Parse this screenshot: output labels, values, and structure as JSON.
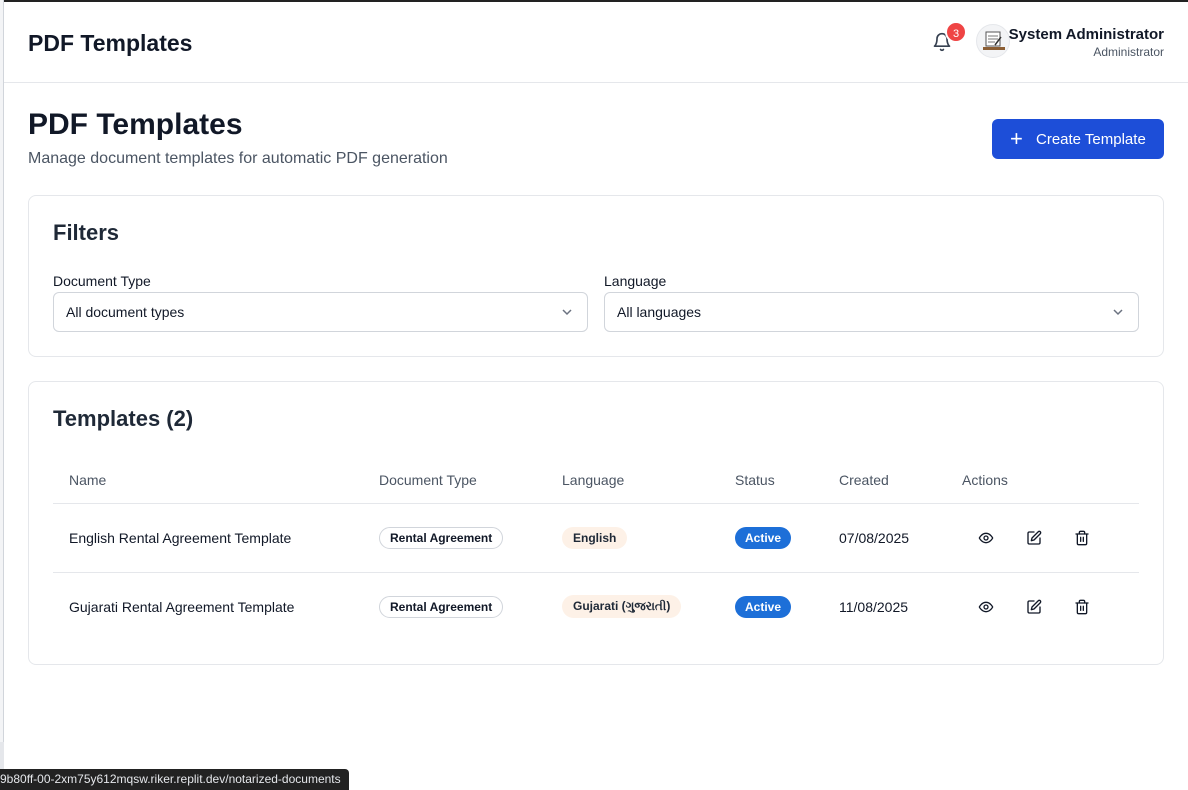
{
  "header": {
    "title": "PDF Templates",
    "notification_count": "3",
    "user_name": "System Administrator",
    "user_role": "Administrator"
  },
  "page": {
    "title": "PDF Templates",
    "subtitle": "Manage document templates for automatic PDF generation",
    "create_button": "Create Template"
  },
  "filters": {
    "title": "Filters",
    "document_type": {
      "label": "Document Type",
      "value": "All document types"
    },
    "language": {
      "label": "Language",
      "value": "All languages"
    }
  },
  "templates": {
    "title": "Templates (2)",
    "columns": [
      "Name",
      "Document Type",
      "Language",
      "Status",
      "Created",
      "Actions"
    ],
    "rows": [
      {
        "name": "English Rental Agreement Template",
        "document_type": "Rental Agreement",
        "language": "English",
        "status": "Active",
        "created": "07/08/2025"
      },
      {
        "name": "Gujarati Rental Agreement Template",
        "document_type": "Rental Agreement",
        "language": "Gujarati (ગુજરાતી)",
        "status": "Active",
        "created": "11/08/2025"
      }
    ]
  },
  "status_bar": {
    "url": "9b80ff-00-2xm75y612mqsw.riker.replit.dev/notarized-documents"
  },
  "colors": {
    "primary": "#1d4ed8",
    "active_badge": "#1d6fd8",
    "notification": "#ef4444",
    "language_pill": "#fdf1e7"
  },
  "icons": {
    "notification": "bell-icon",
    "create": "plus-icon",
    "select": "chevron-down-icon",
    "view": "eye-icon",
    "edit": "edit-icon",
    "delete": "trash-icon"
  }
}
